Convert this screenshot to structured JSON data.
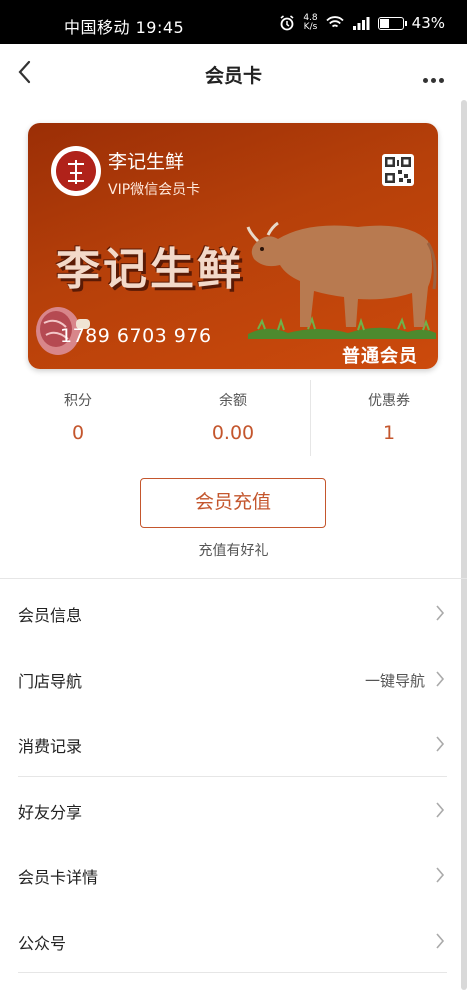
{
  "status_bar": {
    "carrier_time": "中国移动 19:45",
    "speed_top": "4.8",
    "speed_unit": "K/s",
    "battery": "43%",
    "battery_level": 0.43,
    "icons": [
      "alarm-icon",
      "wifi-icon",
      "signal-icon",
      "battery-icon"
    ]
  },
  "nav": {
    "title": "会员卡"
  },
  "card": {
    "shop_name": "李记生鲜",
    "card_type": "VIP微信会员卡",
    "brand_text": "李记生鲜",
    "card_number": "1789 6703 976",
    "member_level": "普通会员",
    "logo_text": "李记",
    "colors": {
      "card_top": "#9b2e06",
      "card_bottom": "#cc4a0c"
    }
  },
  "stats": [
    {
      "label": "积分",
      "value": "0"
    },
    {
      "label": "余额",
      "value": "0.00"
    },
    {
      "label": "优惠券",
      "value": "1"
    }
  ],
  "recharge": {
    "button_label": "会员充值",
    "tip": "充值有好礼"
  },
  "menu": [
    {
      "label": "会员信息",
      "extra": ""
    },
    {
      "label": "门店导航",
      "extra": "一键导航"
    },
    {
      "label": "消费记录",
      "extra": ""
    },
    {
      "label": "好友分享",
      "extra": ""
    },
    {
      "label": "会员卡详情",
      "extra": ""
    },
    {
      "label": "公众号",
      "extra": ""
    }
  ],
  "colors": {
    "accent": "#c4562d",
    "status_bg": "#000000"
  }
}
